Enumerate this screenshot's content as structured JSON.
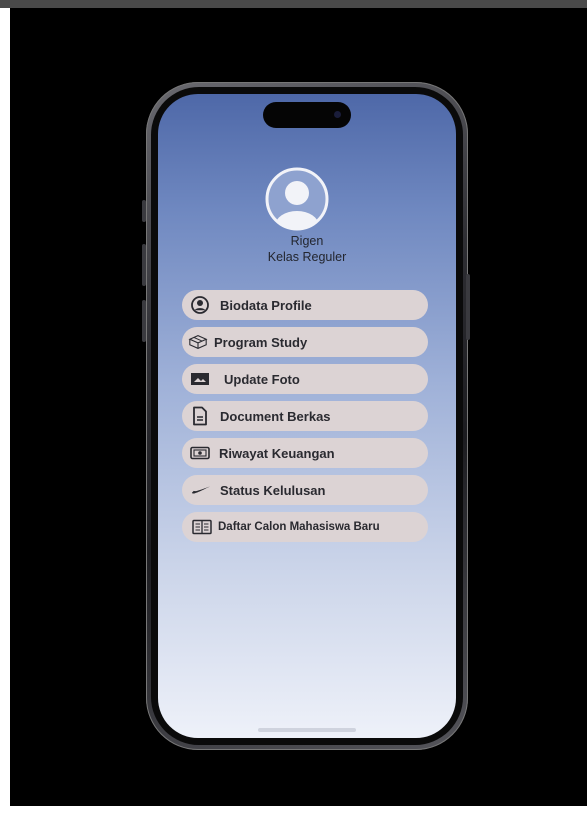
{
  "profile": {
    "name": "Rigen",
    "class": "Kelas Reguler"
  },
  "menu": [
    {
      "label": "Biodata Profile",
      "icon": "person-circle-icon"
    },
    {
      "label": "Program Study",
      "icon": "box-icon"
    },
    {
      "label": "Update Foto",
      "icon": "photo-icon"
    },
    {
      "label": "Document Berkas",
      "icon": "document-icon"
    },
    {
      "label": "Riwayat Keuangan",
      "icon": "money-icon"
    },
    {
      "label": "Status Kelulusan",
      "icon": "swoosh-icon"
    },
    {
      "label": "Daftar Calon Mahasiswa Baru",
      "icon": "book-icon"
    }
  ],
  "colors": {
    "screen_top": "#4e68a8",
    "screen_bottom": "#eef1f9",
    "menu_pill": "#dcd3d4",
    "menu_text": "#2a2a30"
  }
}
